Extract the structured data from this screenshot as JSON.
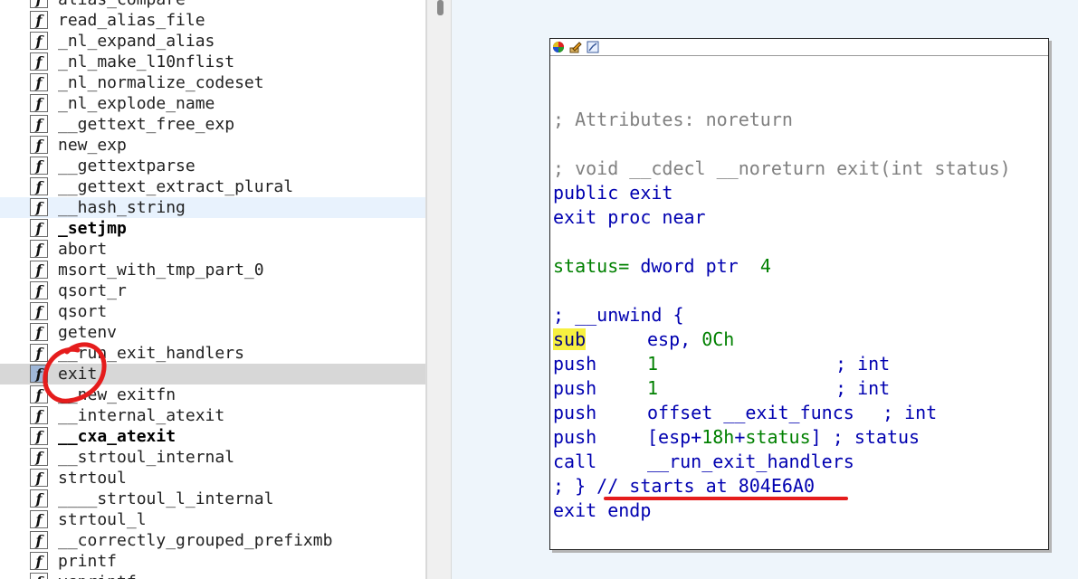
{
  "functions": [
    {
      "name": "alias_compare",
      "bold": false,
      "highlight": ""
    },
    {
      "name": "read_alias_file",
      "bold": false,
      "highlight": ""
    },
    {
      "name": "_nl_expand_alias",
      "bold": false,
      "highlight": ""
    },
    {
      "name": "_nl_make_l10nflist",
      "bold": false,
      "highlight": ""
    },
    {
      "name": "_nl_normalize_codeset",
      "bold": false,
      "highlight": ""
    },
    {
      "name": "_nl_explode_name",
      "bold": false,
      "highlight": ""
    },
    {
      "name": "__gettext_free_exp",
      "bold": false,
      "highlight": ""
    },
    {
      "name": "new_exp",
      "bold": false,
      "highlight": ""
    },
    {
      "name": "__gettextparse",
      "bold": false,
      "highlight": ""
    },
    {
      "name": "__gettext_extract_plural",
      "bold": false,
      "highlight": ""
    },
    {
      "name": "__hash_string",
      "bold": false,
      "highlight": "light"
    },
    {
      "name": "_setjmp",
      "bold": true,
      "highlight": ""
    },
    {
      "name": "abort",
      "bold": false,
      "highlight": ""
    },
    {
      "name": "msort_with_tmp_part_0",
      "bold": false,
      "highlight": ""
    },
    {
      "name": "qsort_r",
      "bold": false,
      "highlight": ""
    },
    {
      "name": "qsort",
      "bold": false,
      "highlight": ""
    },
    {
      "name": "getenv",
      "bold": false,
      "highlight": ""
    },
    {
      "name": "__run_exit_handlers",
      "bold": false,
      "highlight": ""
    },
    {
      "name": "exit",
      "bold": false,
      "highlight": "selected"
    },
    {
      "name": "__new_exitfn",
      "bold": false,
      "highlight": ""
    },
    {
      "name": "__internal_atexit",
      "bold": false,
      "highlight": ""
    },
    {
      "name": "__cxa_atexit",
      "bold": true,
      "highlight": ""
    },
    {
      "name": "__strtoul_internal",
      "bold": false,
      "highlight": ""
    },
    {
      "name": "strtoul",
      "bold": false,
      "highlight": ""
    },
    {
      "name": "____strtoul_l_internal",
      "bold": false,
      "highlight": ""
    },
    {
      "name": "strtoul_l",
      "bold": false,
      "highlight": ""
    },
    {
      "name": "__correctly_grouped_prefixmb",
      "bold": false,
      "highlight": ""
    },
    {
      "name": "printf",
      "bold": false,
      "highlight": ""
    },
    {
      "name": "vsprintf",
      "bold": false,
      "highlight": ""
    }
  ],
  "function_badge": "f",
  "disasm": {
    "attributes_comment": "; Attributes: noreturn",
    "proto_comment": "; void __cdecl __noreturn exit(int status)",
    "public_kw": "public",
    "public_name": "exit",
    "proc_name": "exit",
    "proc_kw": "proc near",
    "var_name": "status=",
    "var_type": "dword ptr",
    "var_value": "4",
    "unwind_open": "; __unwind {",
    "ins1_mnem": "sub",
    "ins1_op1": "esp,",
    "ins1_op2": "0Ch",
    "ins2_mnem": "push",
    "ins2_op": "1",
    "ins2_comment": "; int",
    "ins3_mnem": "push",
    "ins3_op": "1",
    "ins3_comment": "; int",
    "ins4_mnem": "push",
    "ins4_op": "offset __exit_funcs",
    "ins4_comment": "; int",
    "ins5_mnem": "push",
    "ins5_op_a": "[esp+",
    "ins5_op_b": "18h",
    "ins5_op_c": "+",
    "ins5_op_d": "status",
    "ins5_op_e": "]",
    "ins5_comment": "; status",
    "ins6_mnem": "call",
    "ins6_op": "__run_exit_handlers",
    "unwind_close": "; }",
    "starts_comment": "// starts at 804E6A0",
    "endp_name": "exit",
    "endp_kw": "endp"
  },
  "colors": {
    "annotation_red": "#e51c1c",
    "mnemonic_highlight": "#f7f040",
    "graph_background": "#eef5fb"
  },
  "icons": [
    "color-palette-icon",
    "edit-node-icon",
    "graph-overview-icon"
  ]
}
